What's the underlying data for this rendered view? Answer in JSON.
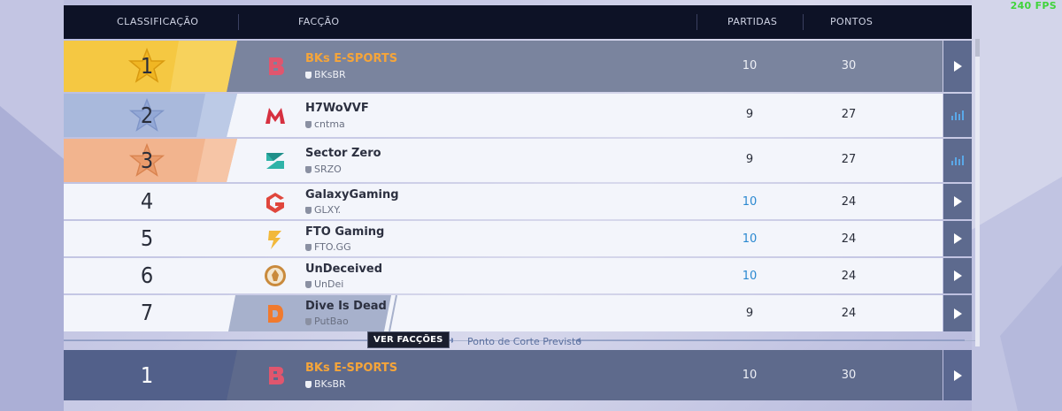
{
  "fps": "240 FPS",
  "header": {
    "rank": "CLASSIFICAÇÃO",
    "faction": "FACÇÃO",
    "matches": "PARTIDAS",
    "points": "PONTOS"
  },
  "rows": [
    {
      "rank": "1",
      "name": "BKs E-SPORTS",
      "tag": "BKsBR",
      "matches": "10",
      "points": "30",
      "action": "play-icon"
    },
    {
      "rank": "2",
      "name": "H7WoVVF",
      "tag": "cntma",
      "matches": "9",
      "points": "27",
      "action": "stats-icon"
    },
    {
      "rank": "3",
      "name": "Sector Zero",
      "tag": "SRZO",
      "matches": "9",
      "points": "27",
      "action": "stats-icon"
    },
    {
      "rank": "4",
      "name": "GalaxyGaming",
      "tag": "GLXY.",
      "matches": "10",
      "points": "24",
      "action": "play-icon"
    },
    {
      "rank": "5",
      "name": "FTO Gaming",
      "tag": "FTO.GG",
      "matches": "10",
      "points": "24",
      "action": "play-icon"
    },
    {
      "rank": "6",
      "name": "UnDeceived",
      "tag": "UnDei",
      "matches": "10",
      "points": "24",
      "action": "play-icon"
    },
    {
      "rank": "7",
      "name": "Dive Is Dead",
      "tag": "PutBao",
      "matches": "9",
      "points": "24",
      "action": "play-icon"
    }
  ],
  "cut_line": "Ponto de Corte Previsto",
  "tooltip": "VER FACÇÕES",
  "my_row": {
    "rank": "1",
    "name": "BKs E-SPORTS",
    "tag": "BKsBR",
    "matches": "10",
    "points": "30"
  },
  "colors": {
    "gold": "#f5c842",
    "silver": "#a9b9dc",
    "bronze": "#f2b48e",
    "accent_name": "#f5a53a",
    "matches_blue": "#2a88d0",
    "header_bg": "#0d1226"
  }
}
